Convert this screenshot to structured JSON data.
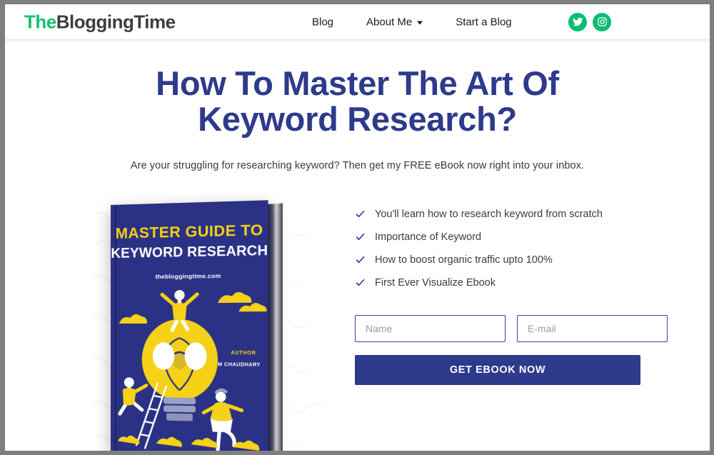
{
  "header": {
    "logo": {
      "part1": "The",
      "part2": "BloggingTime"
    },
    "nav": [
      {
        "label": "Blog",
        "has_dropdown": false
      },
      {
        "label": "About Me",
        "has_dropdown": true
      },
      {
        "label": "Start a Blog",
        "has_dropdown": false
      }
    ],
    "socials": [
      {
        "name": "twitter",
        "icon": "twitter-icon"
      },
      {
        "name": "instagram",
        "icon": "instagram-icon"
      }
    ],
    "accent_green": "#0bbd72",
    "logo_text_color": "#3d3d3d"
  },
  "hero": {
    "title": "How To Master The Art Of Keyword Research?",
    "subtitle": "Are your struggling for researching keyword? Then get my FREE eBook now right into your inbox.",
    "title_color": "#2e3a8c"
  },
  "book": {
    "title_line1": "MASTER GUIDE TO",
    "title_line2": "KEYWORD RESEARCH",
    "url": "thebloggingtime.com",
    "author_label": "AUTHOR",
    "author_name": "SHUBHAM CHAUDHARY",
    "cover_color": "#2b3285",
    "accent_yellow": "#f5d117"
  },
  "offer": {
    "benefits": [
      "You'll learn how to research keyword from scratch",
      "Importance of Keyword",
      "How to boost organic traffic upto 100%",
      "First Ever Visualize Ebook"
    ],
    "form": {
      "name_placeholder": "Name",
      "name_value": "",
      "email_placeholder": "E-mail",
      "email_value": "",
      "submit_label": "GET EBOOK NOW",
      "submit_color": "#2e3a8c"
    }
  }
}
